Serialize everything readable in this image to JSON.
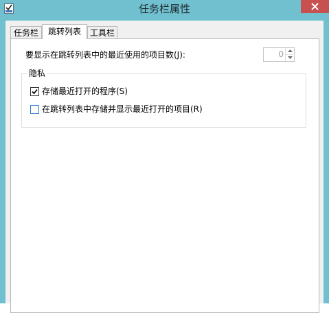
{
  "window": {
    "title": "任务栏属性",
    "icon": "taskbar-properties-icon",
    "close_icon": "close-icon"
  },
  "tabs": [
    {
      "label": "任务栏",
      "active": false
    },
    {
      "label": "跳转列表",
      "active": true
    },
    {
      "label": "工具栏",
      "active": false
    }
  ],
  "jumplist": {
    "recent_items_label": "要显示在跳转列表中的最近使用的项目数(J):",
    "recent_items_value": "0",
    "privacy": {
      "title": "隐私",
      "options": [
        {
          "label": "存储最近打开的程序(S)",
          "checked": true
        },
        {
          "label": "在跳转列表中存储并显示最近打开的项目(R)",
          "checked": false
        }
      ]
    }
  },
  "colors": {
    "frame": "#70c0cf",
    "close_button": "#c75050",
    "checkbox_focus": "#2f7fd0"
  }
}
